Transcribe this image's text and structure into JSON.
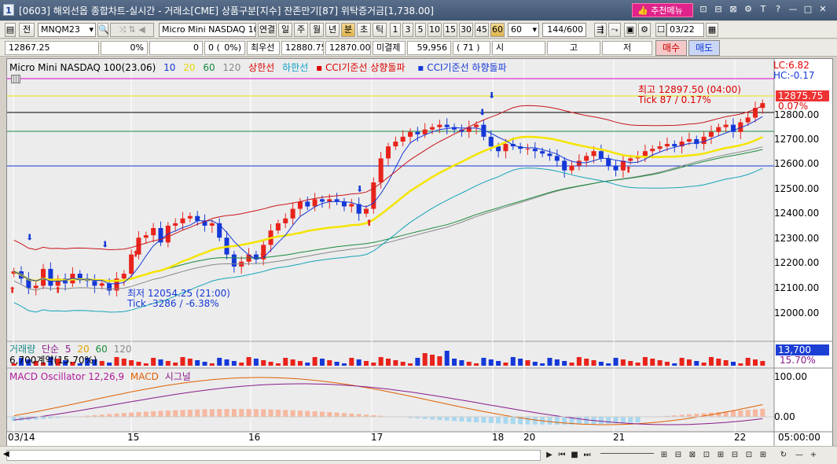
{
  "titlebar": {
    "num": "1",
    "title": "[0603] 해외선옵 종합차트-실시간 - 거래소[CME] 상품구분[지수] 잔존만기[87] 위탁증거금[1,738.00]",
    "recommend": "추천메뉴",
    "icons": [
      "⊡",
      "⊟",
      "⊠",
      "⚙",
      "T",
      "?",
      "—",
      "□",
      "✕"
    ]
  },
  "toolbar1": {
    "jeon": "전",
    "symbol": "MNQM23",
    "symbol_name": "Micro Mini NASDAQ 10",
    "periods": [
      "연결",
      "일",
      "주",
      "월",
      "년",
      "분",
      "초",
      "틱"
    ],
    "active_period": "분",
    "intervals": [
      "1",
      "3",
      "5",
      "10",
      "15",
      "30",
      "45",
      "60"
    ],
    "active_interval": "60",
    "interval_value": "60",
    "count": "144",
    "count_max": "/600",
    "date": "03/22"
  },
  "toolbar2": {
    "last": "12867.25",
    "pct0": "0%",
    "zero1": "0",
    "paren_left": "0 (",
    "pct1": "0%)",
    "best_bid_label": "최우선",
    "best_bid": "12880.75",
    "best_ask": "12870.00",
    "open_interest_label": "미결제",
    "open_interest": "59,956",
    "oi_change": "(    71 )",
    "si": "시",
    "go": "고",
    "jeo": "저",
    "buy": "매수",
    "sell": "매도"
  },
  "legend": {
    "name": "Micro Mini NASDAQ 100(23.06)",
    "ma10": "10",
    "ma20": "20",
    "ma60": "60",
    "ma120": "120",
    "upper": "상한선",
    "lower": "하한선",
    "cci_up": "CCI기준선 상향돌파",
    "cci_down": "CCI기준선 하향돌파"
  },
  "price_labels": {
    "lc": "LC:6.82",
    "hc": "HC:-0.17",
    "high": "최고 12897.50 (04:00)",
    "high_tick": "Tick 87 / 0.17%",
    "low": "최저 12054.25 (21:00)",
    "low_tick": "Tick -3286 / -6.38%",
    "current": "12875.75",
    "current_pct": "0.07%"
  },
  "yaxis": [
    "12800.00",
    "12700.00",
    "12600.00",
    "12500.00",
    "12400.00",
    "12300.00",
    "12200.00",
    "12100.00",
    "12000.00"
  ],
  "volume": {
    "label": "거래량",
    "type": "단순",
    "p5": "5",
    "p20": "20",
    "p60": "60",
    "p120": "120",
    "contract": "6,700계약(15.70%)",
    "tag": "13,700",
    "tag_pct": "15.70%"
  },
  "macd": {
    "osc": "MACD Oscillator 12,26,9",
    "macd": "MACD",
    "signal": "시그널",
    "y100": "100.00",
    "y0": "0.00"
  },
  "xaxis": [
    "03/14",
    "15",
    "16",
    "17",
    "18",
    "20",
    "21",
    "22"
  ],
  "time_label": "05:00:00",
  "colors": {
    "up": "#e8231b",
    "down": "#1438d8",
    "ma5": "#1438d8",
    "ma20_yellow": "#f4e400",
    "ma60_green": "#1a8a3c",
    "ma120_gray": "#777777",
    "bollinger": "#c8161b",
    "bollinger_low": "#14a4b8"
  }
}
